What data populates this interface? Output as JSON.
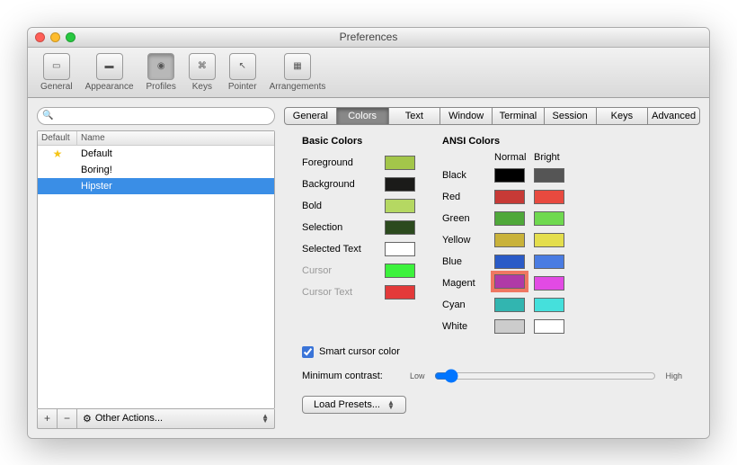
{
  "window": {
    "title": "Preferences"
  },
  "toolbar": {
    "items": [
      {
        "label": "General"
      },
      {
        "label": "Appearance"
      },
      {
        "label": "Profiles"
      },
      {
        "label": "Keys"
      },
      {
        "label": "Pointer"
      },
      {
        "label": "Arrangements"
      }
    ],
    "selected": 2
  },
  "sidebar": {
    "search_placeholder": "",
    "columns": {
      "c1": "Default",
      "c2": "Name"
    },
    "profiles": [
      {
        "default": true,
        "name": "Default"
      },
      {
        "default": false,
        "name": "Boring!"
      },
      {
        "default": false,
        "name": "Hipster"
      }
    ],
    "selected": 2,
    "footer": {
      "add": "+",
      "remove": "−",
      "other": "Other Actions..."
    }
  },
  "tabs": {
    "items": [
      "General",
      "Colors",
      "Text",
      "Window",
      "Terminal",
      "Session",
      "Keys",
      "Advanced"
    ],
    "selected": 1
  },
  "basic": {
    "heading": "Basic Colors",
    "rows": [
      {
        "label": "Foreground",
        "color": "#a3c64a",
        "disabled": false
      },
      {
        "label": "Background",
        "color": "#1b1b19",
        "disabled": false
      },
      {
        "label": "Bold",
        "color": "#b5d862",
        "disabled": false
      },
      {
        "label": "Selection",
        "color": "#2c4a1e",
        "disabled": false
      },
      {
        "label": "Selected Text",
        "color": "#ffffff",
        "disabled": false
      },
      {
        "label": "Cursor",
        "color": "#3cf23c",
        "disabled": true
      },
      {
        "label": "Cursor Text",
        "color": "#e33a3a",
        "disabled": true
      }
    ]
  },
  "ansi": {
    "heading": "ANSI Colors",
    "head": {
      "normal": "Normal",
      "bright": "Bright"
    },
    "rows": [
      {
        "label": "Black",
        "normal": "#000000",
        "bright": "#555555"
      },
      {
        "label": "Red",
        "normal": "#c73a36",
        "bright": "#e84a3f"
      },
      {
        "label": "Green",
        "normal": "#4fa83a",
        "bright": "#6fd94f"
      },
      {
        "label": "Yellow",
        "normal": "#c9b23a",
        "bright": "#e4de4d"
      },
      {
        "label": "Blue",
        "normal": "#2a5bc7",
        "bright": "#4a7ce2"
      },
      {
        "label": "Magent",
        "normal": "#b03aa7",
        "bright": "#e24ae4"
      },
      {
        "label": "Cyan",
        "normal": "#32b5b0",
        "bright": "#45e0dc"
      },
      {
        "label": "White",
        "normal": "#cccccc",
        "bright": "#ffffff"
      }
    ],
    "highlighted": 5
  },
  "smartcursor": {
    "label": "Smart cursor color",
    "checked": true
  },
  "contrast": {
    "label": "Minimum contrast:",
    "low": "Low",
    "high": "High",
    "value": 5
  },
  "load": {
    "label": "Load Presets..."
  }
}
